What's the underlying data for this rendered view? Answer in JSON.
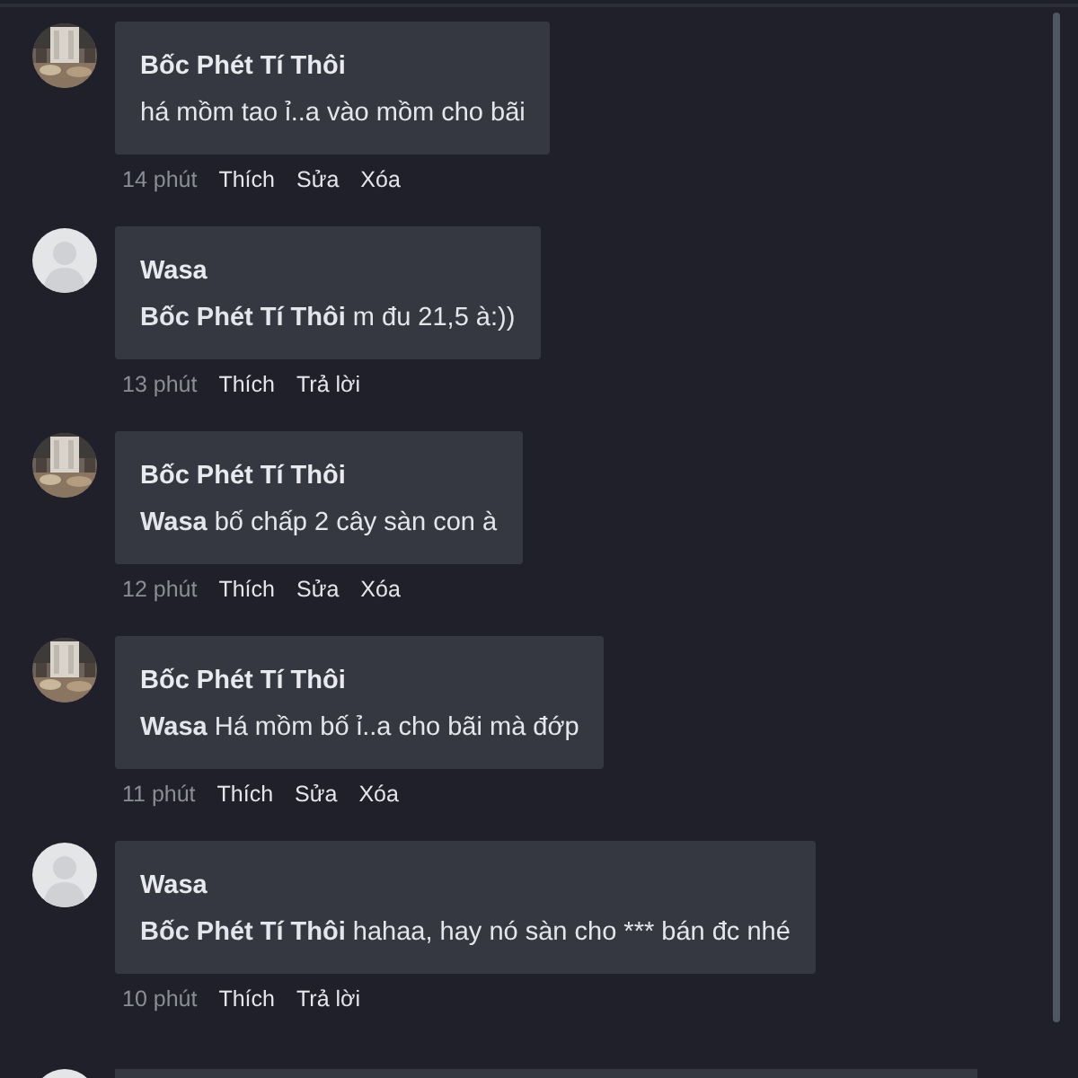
{
  "comments": [
    {
      "author": "Bốc Phét Tí Thôi",
      "text": "há mồm tao ỉ..a vào mồm cho bãi",
      "time": "14 phút",
      "actions": [
        "Thích",
        "Sửa",
        "Xóa"
      ]
    },
    {
      "avatar": {
        "kind": "default"
      },
      "author": "Wasa",
      "text": "**Bốc Phét Tí Thôi** m đu 21,5 à:))",
      "time": "13 phút",
      "actions": [
        "Thích",
        "Trả lời"
      ]
    },
    {
      "author": "Bốc Phét Tí Thôi",
      "text": "**Wasa** bố chấp 2 cây sàn con à",
      "time": "12 phút",
      "actions": [
        "Thích",
        "Sửa",
        "Xóa"
      ]
    },
    {
      "author": "Bốc Phét Tí Thôi",
      "text": "**Wasa** Há mồm bố ỉ..a cho bãi mà đớp",
      "time": "11 phút",
      "actions": [
        "Thích",
        "Sửa",
        "Xóa"
      ]
    },
    {
      "avatar": {
        "kind": "default"
      },
      "author": "Wasa",
      "text": "**Bốc Phét Tí Thôi** hahaa, hay nó sàn cho *** bán đc nhé",
      "time": "10 phút",
      "actions": [
        "Thích",
        "Trả lời"
      ]
    }
  ]
}
